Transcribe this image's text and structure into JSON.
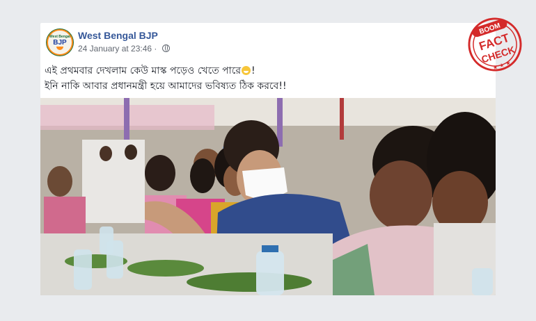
{
  "post": {
    "page_name": "West Bengal BJP",
    "timestamp": "24 January at 23:46",
    "privacy_icon": "globe-icon",
    "text_lines": [
      "এই প্রথমবার দেখলাম কেউ মাস্ক পড়েও খেতে পারে",
      "!",
      "ইনি নাকি আবার প্রধানমন্ত্রী হয়ে আমাদের ভবিষ্যত ঠিক করবে!!"
    ],
    "emoji_icon": "grinning-face-icon"
  },
  "avatar": {
    "top_text": "West Bengal",
    "logo_text": "BJP"
  },
  "stamp": {
    "brand": "BOOM",
    "line1": "FACT",
    "line2": "CHECK",
    "color": "#d42a2a"
  },
  "colors": {
    "page_name": "#365899",
    "background": "#e9ebee"
  }
}
